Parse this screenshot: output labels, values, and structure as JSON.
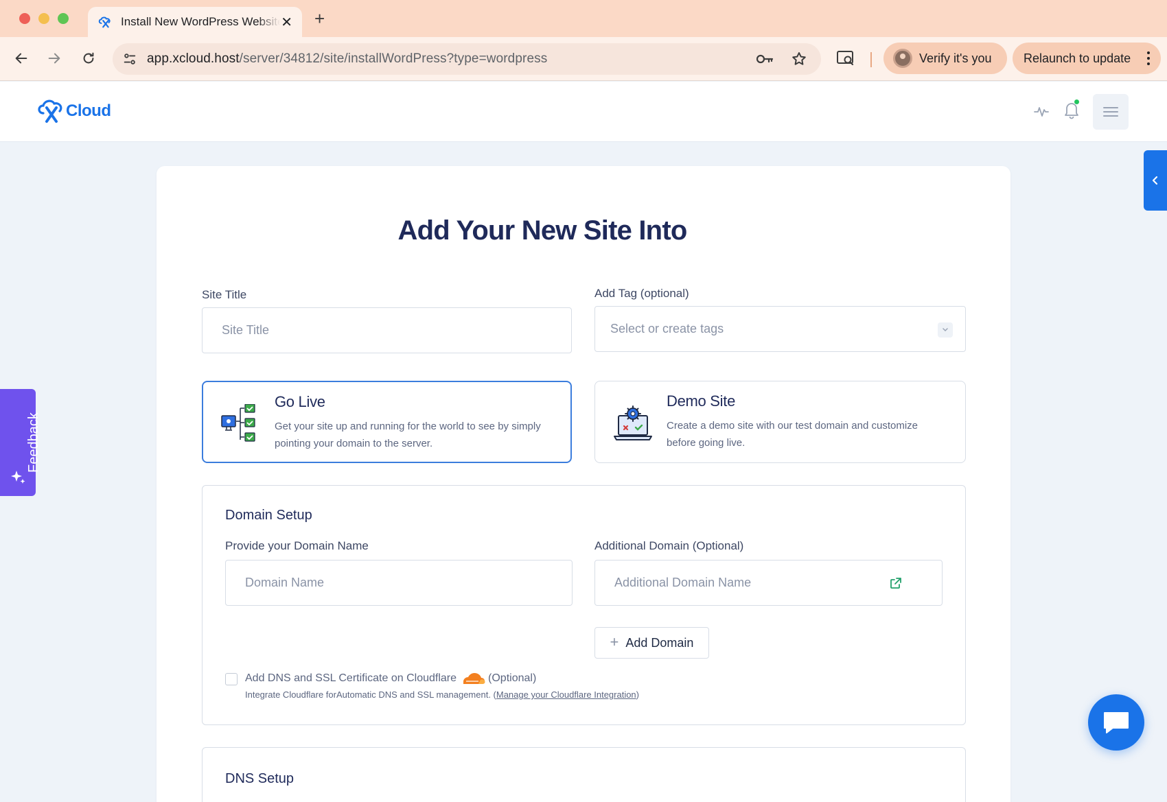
{
  "browser": {
    "tab_title": "Install New WordPress Website",
    "url_host": "app.xcloud.host",
    "url_path": "/server/34812/site/installWordPress?type=wordpress",
    "verify_label": "Verify it's you",
    "relaunch_label": "Relaunch to update"
  },
  "header": {
    "logo_text": "Cloud",
    "brand_color": "#1a73e8",
    "notification_dot_color": "#22c55e"
  },
  "feedback": {
    "label": "Feedback",
    "color": "#6f52ed"
  },
  "page": {
    "title": "Add Your New Site Into",
    "site_title": {
      "label": "Site Title",
      "placeholder": "Site Title",
      "value": ""
    },
    "tags": {
      "label": "Add Tag (optional)",
      "placeholder": "Select or create tags"
    },
    "options": [
      {
        "title": "Go Live",
        "description": "Get your site up and running for the world to see by simply pointing your domain to the server.",
        "selected": true,
        "icon": "server-checklist-icon"
      },
      {
        "title": "Demo Site",
        "description": "Create a demo site with our test domain and customize before going live.",
        "selected": false,
        "icon": "laptop-gear-icon"
      }
    ],
    "domain_setup": {
      "title": "Domain Setup",
      "domain_label": "Provide your Domain Name",
      "domain_placeholder": "Domain Name",
      "additional_label": "Additional Domain (Optional)",
      "additional_placeholder": "Additional Domain Name",
      "add_domain_label": "Add Domain",
      "cloudflare_label_before": "Add DNS and SSL Certificate on Cloudflare",
      "cloudflare_label_after": "(Optional)",
      "cloudflare_note": "Integrate Cloudflare forAutomatic DNS and SSL management. (",
      "cloudflare_link": "Manage your Cloudflare Integration",
      "cloudflare_note_end": ")",
      "cloudflare_checked": false
    },
    "dns_setup": {
      "title": "DNS Setup"
    }
  }
}
